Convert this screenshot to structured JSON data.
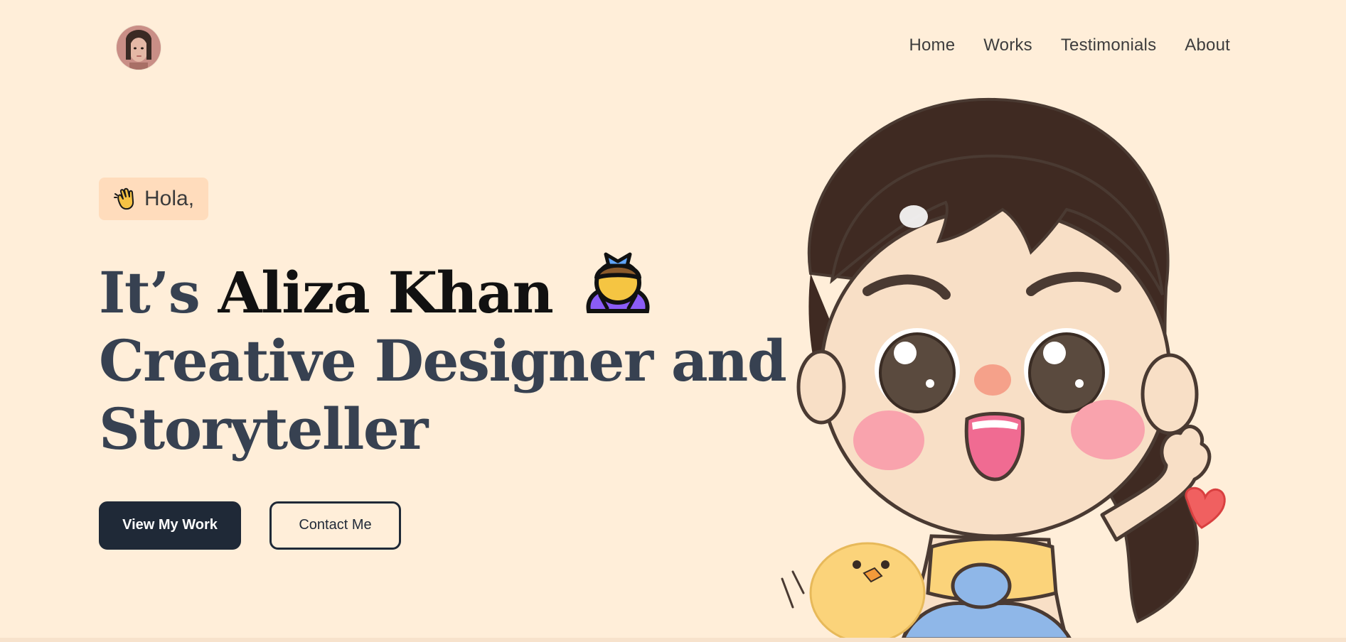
{
  "nav": {
    "links": [
      "Home",
      "Works",
      "Testimonials",
      "About"
    ]
  },
  "hero": {
    "greeting": "Hola,",
    "greeting_icon": "waving-hand-icon",
    "line1_prefix": "It’s",
    "name": "Aliza Khan",
    "name_icon": "woman-bowing-icon",
    "line2": "Creative Designer and",
    "line3": "Storyteller"
  },
  "buttons": {
    "primary": "View My Work",
    "secondary": "Contact Me"
  },
  "colors": {
    "background": "#ffeed9",
    "greeting_bg": "#ffdcbc",
    "primary_button": "#1f2937",
    "heading": "#374151"
  }
}
